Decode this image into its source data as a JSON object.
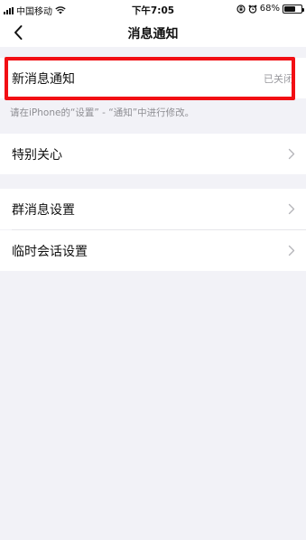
{
  "status_bar": {
    "carrier": "中国移动",
    "time": "下午7:05",
    "battery": "68%",
    "battery_level": 0.68,
    "icons": [
      "signal-icon",
      "wifi-icon",
      "rotation-lock-icon",
      "alarm-icon",
      "battery-icon"
    ]
  },
  "nav": {
    "title": "消息通知",
    "back_icon": "chevron-left-icon"
  },
  "settings": {
    "new_message": {
      "label": "新消息通知",
      "value": "已关闭"
    },
    "hint": "请在iPhone的“设置” - “通知”中进行修改。",
    "special_care": {
      "label": "特别关心"
    },
    "group_message": {
      "label": "群消息设置"
    },
    "temp_session": {
      "label": "临时会话设置"
    }
  },
  "colors": {
    "highlight": "#f20f14",
    "background": "#f2f2f7",
    "secondary_text": "#9a9a9f"
  }
}
